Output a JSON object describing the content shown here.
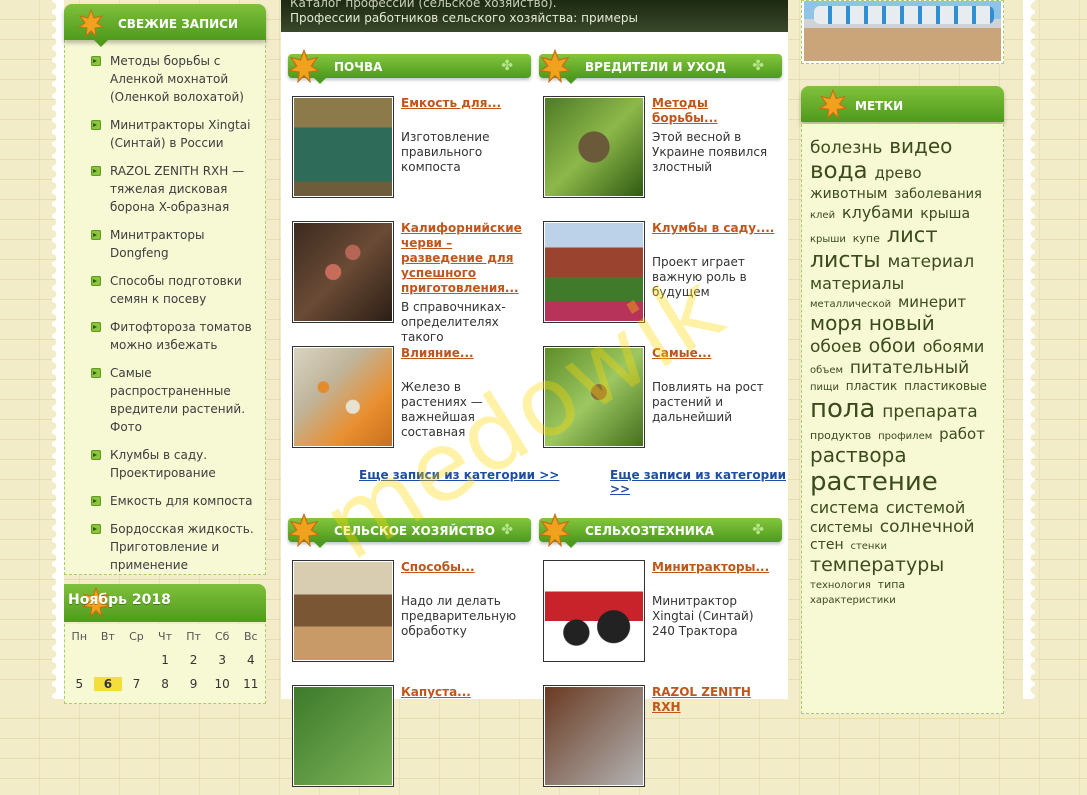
{
  "recent": {
    "title": "СВЕЖИЕ ЗАПИСИ",
    "items": [
      "Методы борьбы с Аленкой мохнатой (Оленкой волохатой)",
      "Минитракторы Xingtai (Синтай) в России",
      "RAZOL ZENITH RXH — тяжелая дисковая борона X-образная",
      "Минитракторы Dongfeng",
      "Способы подготовки семян к посеву",
      "Фитофтороза томатов можно избежать",
      "Самые распространенные вредители растений. Фото",
      "Клумбы в саду. Проектирование",
      "Емкость для компоста",
      "Бордосская жидкость. Приготовление и применение"
    ]
  },
  "calendar": {
    "title": "Ноябрь 2018",
    "dow": [
      "Пн",
      "Вт",
      "Ср",
      "Чт",
      "Пт",
      "Сб",
      "Вс"
    ],
    "row1": [
      "",
      "",
      "",
      "1",
      "2",
      "3",
      "4"
    ],
    "row2": [
      "5",
      "6",
      "7",
      "8",
      "9",
      "10",
      "11"
    ],
    "today": "6"
  },
  "topbar": {
    "line1": "Каталог профессий (сельское хозяйство).",
    "line2": "Профессии работников сельского хозяйства: примеры"
  },
  "categories": {
    "soil": {
      "title": "ПОЧВА",
      "posts": [
        {
          "title": "Емкость для...",
          "excerpt": "Изготовление правильного компоста",
          "image": "compost-bins"
        },
        {
          "title": "Калифорнийские черви – разведение для успешного приготовления...",
          "excerpt": "В справочниках-определителях такого",
          "image": "worms"
        },
        {
          "title": "Влияние...",
          "excerpt": "Железо в растениях — важнейшая составная",
          "image": "fertilizer-granules"
        }
      ],
      "more": "Еще записи из категории >>"
    },
    "pests": {
      "title": "ВРЕДИТЕЛИ И УХОД",
      "posts": [
        {
          "title": "Методы борьбы...",
          "excerpt": "Этой весной в Украине появился злостный",
          "image": "beetle"
        },
        {
          "title": "Клумбы в саду....",
          "excerpt": "Проект играет важную роль в будущем",
          "image": "house-garden"
        },
        {
          "title": "Самые...",
          "excerpt": "Повлиять на рост растений и дальнейший",
          "image": "bugs-on-leaf"
        }
      ],
      "more": "Еще записи из категории >>"
    },
    "agri": {
      "title": "СЕЛЬСКОЕ ХОЗЯЙСТВО",
      "posts": [
        {
          "title": "Способы...",
          "excerpt": "Надо ли делать предварительную обработку",
          "image": "seeds"
        },
        {
          "title": "Капуста...",
          "excerpt": "",
          "image": "cabbage"
        }
      ]
    },
    "machinery": {
      "title": "СЕЛЬХОЗТЕХНИКА",
      "posts": [
        {
          "title": "Минитракторы...",
          "excerpt": "Минитрактор Xingtai (Синтай) 240 Трактора",
          "image": "red-tractor"
        },
        {
          "title": "RAZOL ZENITH RXH",
          "excerpt": "",
          "image": "disc-harrow"
        }
      ]
    }
  },
  "tags": {
    "title": "МЕТКИ",
    "items": [
      {
        "t": "болезнь",
        "s": 17
      },
      {
        "t": "видео",
        "s": 20
      },
      {
        "t": "вода",
        "s": 23
      },
      {
        "t": "древо",
        "s": 15
      },
      {
        "t": "животным",
        "s": 14
      },
      {
        "t": "заболевания",
        "s": 13
      },
      {
        "t": "клей",
        "s": 10
      },
      {
        "t": "клубами",
        "s": 16
      },
      {
        "t": "крыша",
        "s": 14
      },
      {
        "t": "крыши",
        "s": 10
      },
      {
        "t": "купе",
        "s": 11
      },
      {
        "t": "лист",
        "s": 21
      },
      {
        "t": "листы",
        "s": 22
      },
      {
        "t": "материал",
        "s": 17
      },
      {
        "t": "материалы",
        "s": 16
      },
      {
        "t": "металлической",
        "s": 10
      },
      {
        "t": "минерит",
        "s": 15
      },
      {
        "t": "моря",
        "s": 20
      },
      {
        "t": "новый",
        "s": 20
      },
      {
        "t": "обоев",
        "s": 17
      },
      {
        "t": "обои",
        "s": 19
      },
      {
        "t": "обоями",
        "s": 16
      },
      {
        "t": "объем",
        "s": 10
      },
      {
        "t": "питательный",
        "s": 17
      },
      {
        "t": "пищи",
        "s": 10
      },
      {
        "t": "пластик",
        "s": 12
      },
      {
        "t": "пластиковые",
        "s": 12
      },
      {
        "t": "пола",
        "s": 26
      },
      {
        "t": "препарата",
        "s": 17
      },
      {
        "t": "продуктов",
        "s": 11
      },
      {
        "t": "профилем",
        "s": 10
      },
      {
        "t": "работ",
        "s": 15
      },
      {
        "t": "раствора",
        "s": 20
      },
      {
        "t": "растение",
        "s": 26
      },
      {
        "t": "система",
        "s": 16
      },
      {
        "t": "системой",
        "s": 16
      },
      {
        "t": "системы",
        "s": 14
      },
      {
        "t": "солнечной",
        "s": 17
      },
      {
        "t": "стен",
        "s": 14
      },
      {
        "t": "стенки",
        "s": 10
      },
      {
        "t": "температуры",
        "s": 19
      },
      {
        "t": "технология",
        "s": 10
      },
      {
        "t": "типа",
        "s": 11
      },
      {
        "t": "характеристики",
        "s": 10
      }
    ]
  },
  "watermark": "medowik",
  "colors": {
    "accent_green": "#5aa524",
    "link": "#c0561c",
    "more_link": "#1f4ea1",
    "today_bg": "#f4de3a"
  }
}
